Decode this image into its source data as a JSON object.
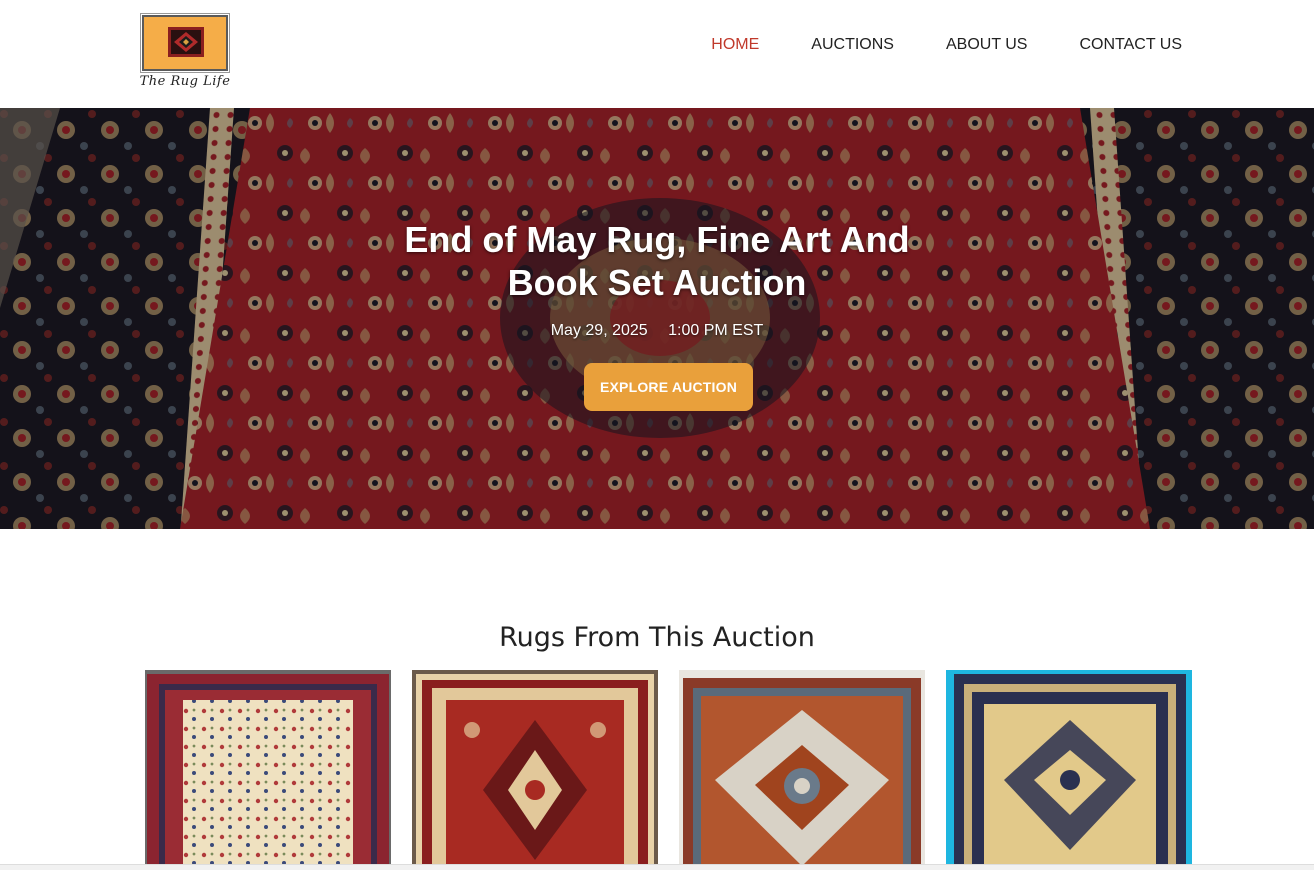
{
  "header": {
    "logo_text": "The Rug Life",
    "nav": [
      {
        "label": "HOME",
        "active": true
      },
      {
        "label": "AUCTIONS",
        "active": false
      },
      {
        "label": "ABOUT US",
        "active": false
      },
      {
        "label": "CONTACT US",
        "active": false
      }
    ]
  },
  "hero": {
    "title_line1": "End of May Rug, Fine Art And",
    "title_line2": "Book Set Auction",
    "date": "May 29, 2025",
    "time": "1:00 PM EST",
    "button_label": "EXPLORE AUCTION"
  },
  "rugs_section": {
    "title": "Rugs From This Auction"
  },
  "colors": {
    "accent": "#e9a03b",
    "nav_active": "#c0392b",
    "text": "#222222"
  }
}
